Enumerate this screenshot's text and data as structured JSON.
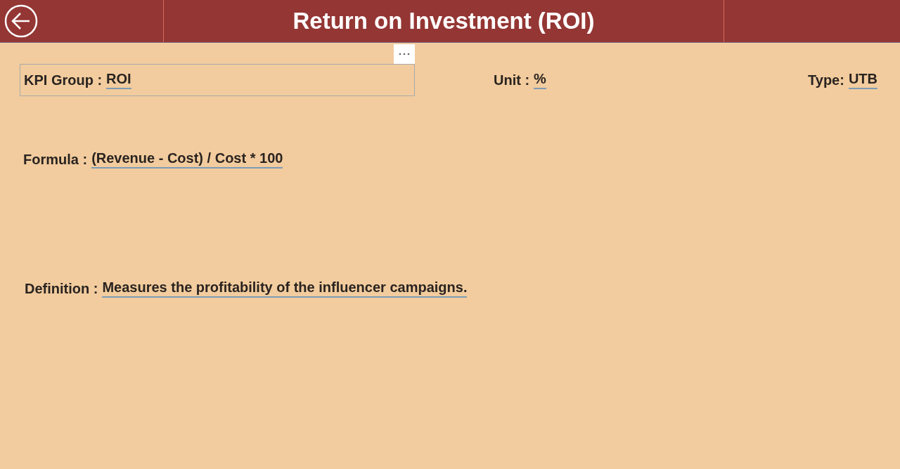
{
  "header": {
    "title": "Return on Investment (ROI)"
  },
  "top_fields": [
    {
      "label": "KPI Group :",
      "value": "ROI"
    },
    {
      "label": "Unit :",
      "value": "%"
    },
    {
      "label": "Type:",
      "value": "UTB"
    }
  ],
  "formula": {
    "label": "Formula :",
    "value": "(Revenue - Cost) / Cost * 100"
  },
  "definition": {
    "label": "Definition :",
    "value": "Measures the profitability of the influencer campaigns."
  }
}
